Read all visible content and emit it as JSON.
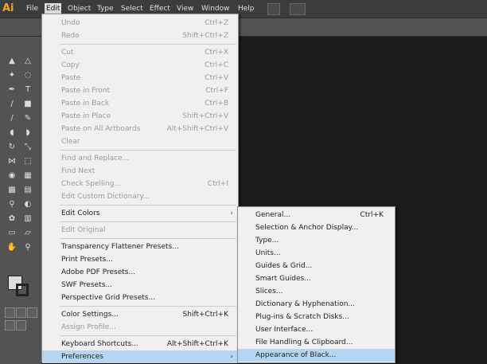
{
  "app": {
    "logo": "Ai"
  },
  "menubar": [
    "File",
    "Edit",
    "Object",
    "Type",
    "Select",
    "Effect",
    "View",
    "Window",
    "Help"
  ],
  "edit_menu": [
    {
      "label": "Undo",
      "shortcut": "Ctrl+Z",
      "disabled": true
    },
    {
      "label": "Redo",
      "shortcut": "Shift+Ctrl+Z",
      "disabled": true
    },
    {
      "sep": true
    },
    {
      "label": "Cut",
      "shortcut": "Ctrl+X",
      "disabled": true
    },
    {
      "label": "Copy",
      "shortcut": "Ctrl+C",
      "disabled": true
    },
    {
      "label": "Paste",
      "shortcut": "Ctrl+V",
      "disabled": true
    },
    {
      "label": "Paste in Front",
      "shortcut": "Ctrl+F",
      "disabled": true
    },
    {
      "label": "Paste in Back",
      "shortcut": "Ctrl+B",
      "disabled": true
    },
    {
      "label": "Paste in Place",
      "shortcut": "Shift+Ctrl+V",
      "disabled": true
    },
    {
      "label": "Paste on All Artboards",
      "shortcut": "Alt+Shift+Ctrl+V",
      "disabled": true
    },
    {
      "label": "Clear",
      "shortcut": "",
      "disabled": true
    },
    {
      "sep": true
    },
    {
      "label": "Find and Replace...",
      "shortcut": "",
      "disabled": true
    },
    {
      "label": "Find Next",
      "shortcut": "",
      "disabled": true
    },
    {
      "label": "Check Spelling...",
      "shortcut": "Ctrl+I",
      "disabled": true
    },
    {
      "label": "Edit Custom Dictionary...",
      "shortcut": "",
      "disabled": true
    },
    {
      "sep": true
    },
    {
      "label": "Edit Colors",
      "shortcut": "",
      "disabled": false,
      "submenu": true
    },
    {
      "sep": true
    },
    {
      "label": "Edit Original",
      "shortcut": "",
      "disabled": true
    },
    {
      "sep": true
    },
    {
      "label": "Transparency Flattener Presets...",
      "shortcut": "",
      "disabled": false
    },
    {
      "label": "Print Presets...",
      "shortcut": "",
      "disabled": false
    },
    {
      "label": "Adobe PDF Presets...",
      "shortcut": "",
      "disabled": false
    },
    {
      "label": "SWF Presets...",
      "shortcut": "",
      "disabled": false
    },
    {
      "label": "Perspective Grid Presets...",
      "shortcut": "",
      "disabled": false
    },
    {
      "sep": true
    },
    {
      "label": "Color Settings...",
      "shortcut": "Shift+Ctrl+K",
      "disabled": false
    },
    {
      "label": "Assign Profile...",
      "shortcut": "",
      "disabled": true
    },
    {
      "sep": true
    },
    {
      "label": "Keyboard Shortcuts...",
      "shortcut": "Alt+Shift+Ctrl+K",
      "disabled": false
    },
    {
      "label": "Preferences",
      "shortcut": "",
      "disabled": false,
      "submenu": true,
      "highlight": true
    }
  ],
  "preferences_menu": [
    {
      "label": "General...",
      "shortcut": "Ctrl+K"
    },
    {
      "label": "Selection & Anchor Display...",
      "shortcut": ""
    },
    {
      "label": "Type...",
      "shortcut": ""
    },
    {
      "label": "Units...",
      "shortcut": ""
    },
    {
      "label": "Guides & Grid...",
      "shortcut": ""
    },
    {
      "label": "Smart Guides...",
      "shortcut": ""
    },
    {
      "label": "Slices...",
      "shortcut": ""
    },
    {
      "label": "Dictionary & Hyphenation...",
      "shortcut": ""
    },
    {
      "label": "Plug-ins & Scratch Disks...",
      "shortcut": ""
    },
    {
      "label": "User Interface...",
      "shortcut": ""
    },
    {
      "label": "File Handling & Clipboard...",
      "shortcut": ""
    },
    {
      "label": "Appearance of Black...",
      "shortcut": "",
      "highlight": true
    }
  ],
  "icons": {
    "submenu_arrow": "›",
    "tools": [
      "selection-tool",
      "direct-selection-tool",
      "magic-wand-tool",
      "lasso-tool",
      "pen-tool",
      "type-tool",
      "line-tool",
      "rectangle-tool",
      "paintbrush-tool",
      "pencil-tool",
      "blob-brush-tool",
      "eraser-tool",
      "rotate-tool",
      "scale-tool",
      "width-tool",
      "free-transform-tool",
      "shape-builder-tool",
      "perspective-grid-tool",
      "mesh-tool",
      "gradient-tool",
      "eyedropper-tool",
      "blend-tool",
      "symbol-sprayer-tool",
      "column-graph-tool",
      "artboard-tool",
      "slice-tool",
      "hand-tool",
      "zoom-tool"
    ]
  },
  "colors": {
    "accent_logo": "#f7a31c",
    "menu_highlight": "#b5d5f0"
  }
}
